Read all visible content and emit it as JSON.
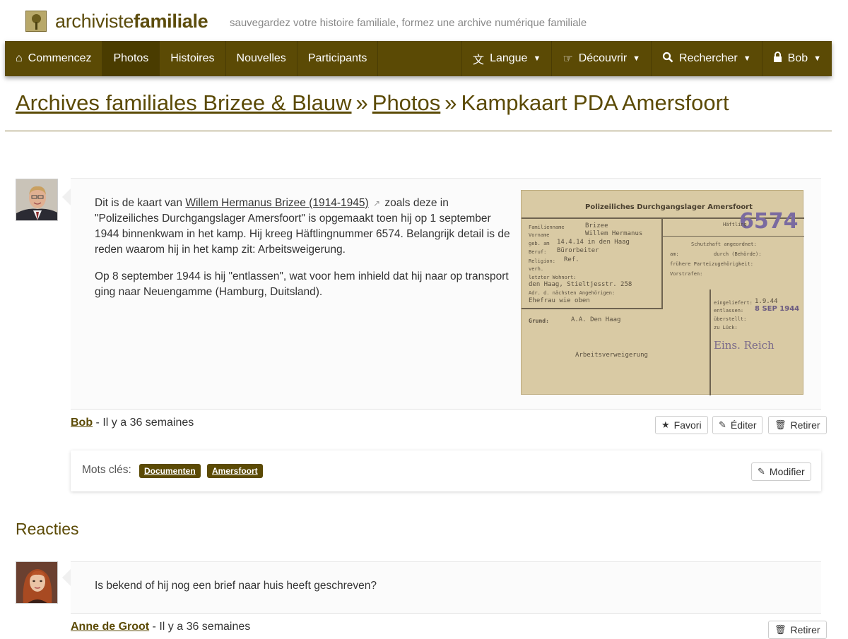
{
  "site": {
    "brand_light": "archiviste",
    "brand_bold": "familiale",
    "tagline": "sauvegardez votre histoire familiale, formez une archive numérique familiale"
  },
  "nav": {
    "left": [
      {
        "label": "Commencez",
        "icon": "home-icon"
      },
      {
        "label": "Photos",
        "active": true
      },
      {
        "label": "Histoires"
      },
      {
        "label": "Nouvelles"
      },
      {
        "label": "Participants"
      }
    ],
    "right": [
      {
        "label": "Langue",
        "icon": "translate-icon"
      },
      {
        "label": "Découvrir",
        "icon": "hand-point-icon"
      },
      {
        "label": "Rechercher",
        "icon": "search-icon"
      },
      {
        "label": "Bob",
        "icon": "lock-icon"
      }
    ]
  },
  "breadcrumb": {
    "root": "Archives familiales Brizee & Blauw",
    "section": "Photos",
    "current": "Kampkaart PDA Amersfoort",
    "separator": "»"
  },
  "post": {
    "p1_before": "Dit is de kaart van ",
    "p1_link": "Willem Hermanus Brizee (1914-1945)",
    "p1_after": " zoals deze in \"Polizeiliches Durchgangslager Amersfoort\" is opgemaakt toen hij op 1 september 1944 binnenkwam in het kamp. Hij kreeg Häftlingnummer 6574. Belangrijk detail is de reden waarom hij in het kamp zit: Arbeitsweigerung.",
    "p2": "Op 8 september 1944 is hij \"entlassen\", wat voor hem inhield dat hij naar op transport ging naar Neuengamme (Hamburg, Duitsland).",
    "author": "Bob",
    "time": " - Il y a 36 semaines",
    "buttons": {
      "favorite": "Favori",
      "edit": "Éditer",
      "remove": "Retirer"
    }
  },
  "card": {
    "title": "Polizeiliches Durchgangslager Amersfoort",
    "number": "6574",
    "fields": {
      "familienname": "Familienname",
      "vorname": "Vorname",
      "geb": "geb. am",
      "beruf": "Beruf:",
      "religion": "Religion:",
      "verh": "verh.",
      "wohnort": "letzter Wohnort:",
      "angeh": "Adr. d. nächsten Angehörigen:",
      "grund": "Grund:",
      "haftling": "Häftling",
      "schutzhaft": "Schutzhaft angeordnet:",
      "am": "am:",
      "durch": "durch (Behörde):",
      "parteizug": "frühere Parteizugehörigkeit:",
      "vorstrafen": "Vorstrafen:",
      "eingeliefert": "eingeliefert:",
      "entlassen": "entlassen:",
      "uberstellt": "überstellt:",
      "zu": "zu Lück:"
    },
    "values": {
      "name": "Brizee",
      "first": "Willem Hermanus",
      "born": "14.4.14   in den Haag",
      "job": "Bürorbeiter",
      "rel": "Ref.",
      "addr": "den Haag, Stieltjesstr. 258",
      "kin": "Ehefrau wie oben",
      "grund_val": "A.A. Den Haag",
      "reason": "Arbeitsverweigerung",
      "in_date": "1.9.44",
      "out_date": "8 SEP 1944",
      "stamp": "Eins. Reich"
    }
  },
  "tags": {
    "label": "Mots clés:",
    "items": [
      "Documenten",
      "Amersfoort"
    ],
    "modify": "Modifier"
  },
  "reactions": {
    "title": "Reacties",
    "comment": "Is bekend of hij nog een brief naar huis heeft geschreven?",
    "author": "Anne de Groot",
    "time": " - Il y a 36 semaines",
    "remove": "Retirer"
  }
}
